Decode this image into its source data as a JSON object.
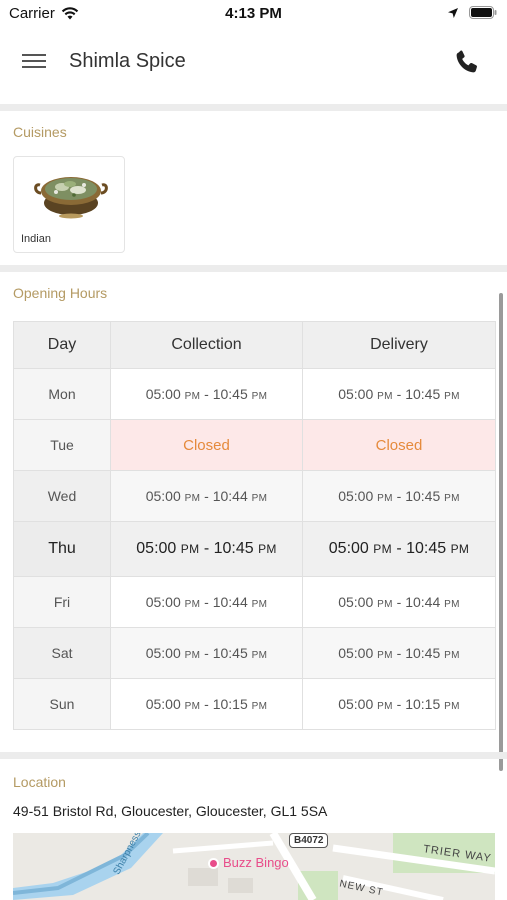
{
  "status_bar": {
    "carrier": "Carrier",
    "time": "4:13 PM"
  },
  "nav": {
    "title": "Shimla Spice",
    "icons": [
      "hamburger-menu-icon",
      "phone-icon"
    ]
  },
  "cuisines": {
    "label": "Cuisines",
    "items": [
      {
        "name": "Indian",
        "icon": "curry-dish-image"
      }
    ]
  },
  "hours": {
    "label": "Opening Hours",
    "columns": [
      "Day",
      "Collection",
      "Delivery"
    ],
    "rows": [
      {
        "day": "Mon",
        "collection": {
          "open": "05:00",
          "open_p": "PM",
          "close": "10:45",
          "close_p": "PM"
        },
        "delivery": {
          "open": "05:00",
          "open_p": "PM",
          "close": "10:45",
          "close_p": "PM"
        }
      },
      {
        "day": "Tue",
        "closed": true,
        "collection_text": "Closed",
        "delivery_text": "Closed"
      },
      {
        "day": "Wed",
        "collection": {
          "open": "05:00",
          "open_p": "PM",
          "close": "10:44",
          "close_p": "PM"
        },
        "delivery": {
          "open": "05:00",
          "open_p": "PM",
          "close": "10:45",
          "close_p": "PM"
        }
      },
      {
        "day": "Thu",
        "today": true,
        "collection": {
          "open": "05:00",
          "open_p": "PM",
          "close": "10:45",
          "close_p": "PM"
        },
        "delivery": {
          "open": "05:00",
          "open_p": "PM",
          "close": "10:45",
          "close_p": "PM"
        }
      },
      {
        "day": "Fri",
        "collection": {
          "open": "05:00",
          "open_p": "PM",
          "close": "10:44",
          "close_p": "PM"
        },
        "delivery": {
          "open": "05:00",
          "open_p": "PM",
          "close": "10:44",
          "close_p": "PM"
        }
      },
      {
        "day": "Sat",
        "collection": {
          "open": "05:00",
          "open_p": "PM",
          "close": "10:45",
          "close_p": "PM"
        },
        "delivery": {
          "open": "05:00",
          "open_p": "PM",
          "close": "10:45",
          "close_p": "PM"
        }
      },
      {
        "day": "Sun",
        "collection": {
          "open": "05:00",
          "open_p": "PM",
          "close": "10:15",
          "close_p": "PM"
        },
        "delivery": {
          "open": "05:00",
          "open_p": "PM",
          "close": "10:15",
          "close_p": "PM"
        }
      }
    ]
  },
  "location": {
    "label": "Location",
    "address": "49-51 Bristol Rd, Gloucester, Gloucester, GL1 5SA",
    "map": {
      "poi": "Buzz Bingo",
      "road_badge": "B4072",
      "streets": [
        "TRIER WAY",
        "NEW ST",
        "Sharpness C"
      ]
    }
  },
  "colors": {
    "section_label": "#b49a63",
    "closed_text": "#e58a3c",
    "closed_bg": "#fde8e8",
    "poi_pink": "#e84d8a"
  }
}
